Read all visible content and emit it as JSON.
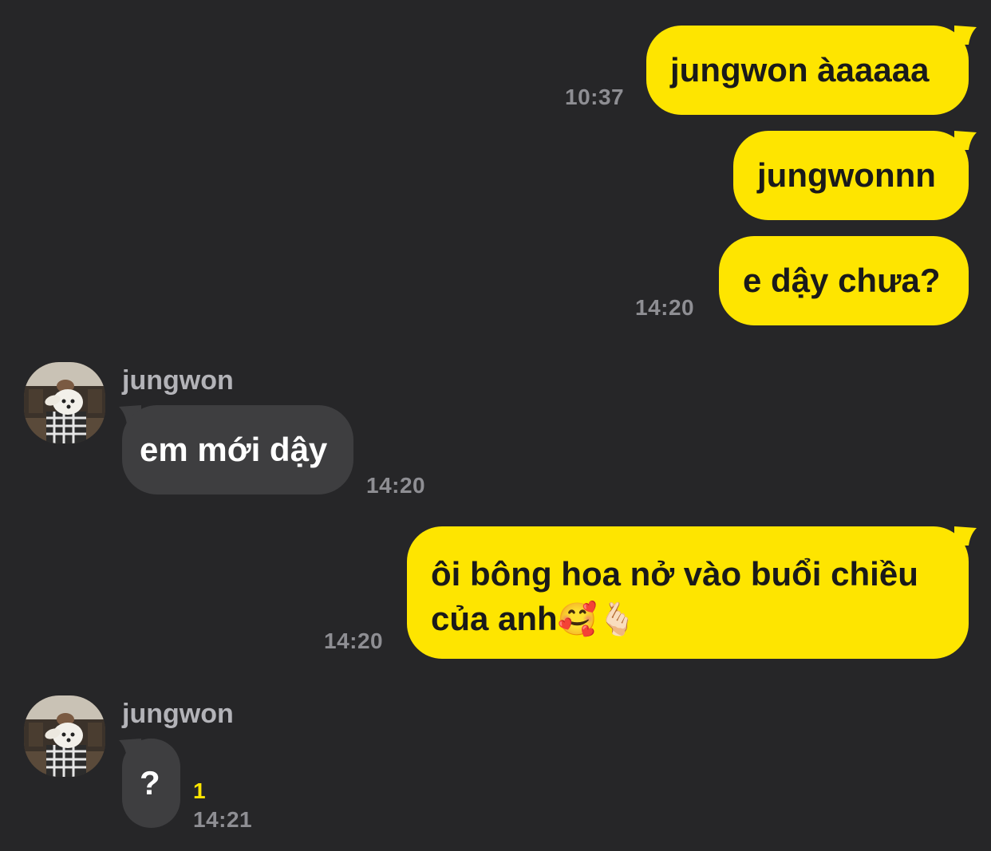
{
  "colors": {
    "background": "#262628",
    "sent_bubble": "#fee500",
    "received_bubble": "#3e3e40",
    "timestamp": "#8e8e93",
    "unread": "#fee500"
  },
  "messages": [
    {
      "direction": "sent",
      "text": "jungwon àaaaaa",
      "time": "10:37"
    },
    {
      "direction": "sent",
      "text": "jungwonnn",
      "time": ""
    },
    {
      "direction": "sent",
      "text": "e dậy chưa?",
      "time": "14:20"
    },
    {
      "direction": "received",
      "sender": "jungwon",
      "avatar_icon": "dog-avatar-icon",
      "text": "em mới dậy",
      "time": "14:20"
    },
    {
      "direction": "sent",
      "line1": "ôi bông hoa nở vào buổi chiều",
      "line2": "của anh",
      "emoji": "🥰🫰🏻",
      "time": "14:20"
    },
    {
      "direction": "received",
      "sender": "jungwon",
      "avatar_icon": "dog-avatar-icon",
      "text": "?",
      "unread": "1",
      "time": "14:21"
    }
  ]
}
